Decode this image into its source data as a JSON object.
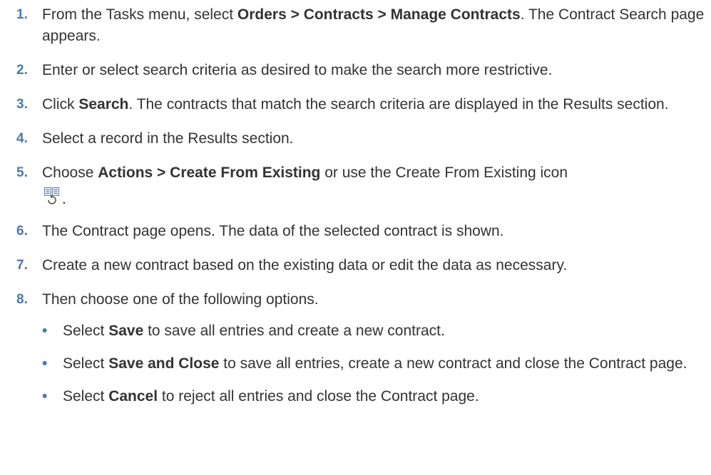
{
  "steps": [
    {
      "num": "1.",
      "t1": "From the Tasks menu, select ",
      "b1": "Orders > Contracts > Manage Contracts",
      "t2": ". The Contract Search page appears."
    },
    {
      "num": "2.",
      "t1": "Enter or select search criteria as desired to make the search more restrictive."
    },
    {
      "num": "3.",
      "t1": "Click ",
      "b1": "Search",
      "t2": ". The contracts that match the search criteria are displayed in the Results section."
    },
    {
      "num": "4.",
      "t1": "Select a record in the Results section."
    },
    {
      "num": "5.",
      "t1": "Choose ",
      "b1": "Actions > Create From Existing",
      "t2": " or use the Create From Existing icon",
      "t3": ".",
      "icon": "create-from-existing-icon"
    },
    {
      "num": "6.",
      "t1": "The Contract page opens. The data of the selected contract is shown."
    },
    {
      "num": "7.",
      "t1": "Create a new contract based on the existing data or edit the data as necessary."
    },
    {
      "num": "8.",
      "t1": "Then choose one of the following options."
    }
  ],
  "options": [
    {
      "bullet": "•",
      "t1": "Select ",
      "b1": "Save",
      "t2": " to save all entries and create a new contract."
    },
    {
      "bullet": "•",
      "t1": "Select ",
      "b1": "Save and Close",
      "t2": " to save all entries, create a new contract and close the Contract page."
    },
    {
      "bullet": "•",
      "t1": "Select ",
      "b1": "Cancel",
      "t2": " to reject all entries and close the Contract page."
    }
  ],
  "colors": {
    "number_accent": "#4a78b0",
    "text": "#333333"
  }
}
